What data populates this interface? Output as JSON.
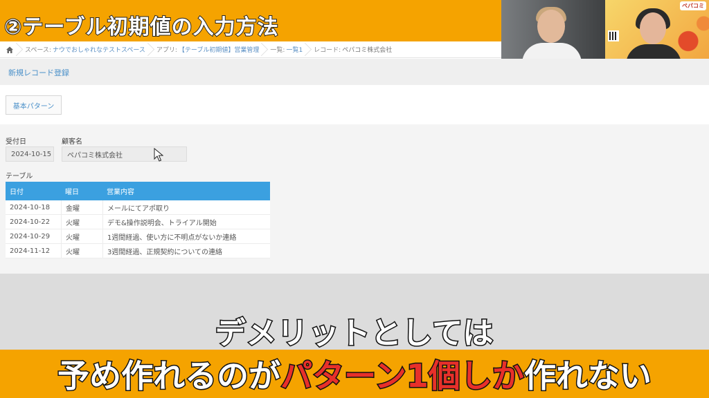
{
  "banner": {
    "title": "②テーブル初期値の入力方法"
  },
  "breadcrumb": [
    {
      "prefix": "スペース:",
      "value": "ナウでおしゃれなテストスペース"
    },
    {
      "prefix": "アプリ:",
      "value": "【テーブル初期値】営業管理"
    },
    {
      "prefix": "一覧:",
      "value": "一覧1"
    },
    {
      "prefix": "レコード:",
      "value": "ペパコミ株式会社"
    }
  ],
  "page": {
    "title": "新規レコード登録",
    "pattern_button": "基本パターン"
  },
  "form": {
    "date_label": "受付日",
    "date_value": "2024-10-15",
    "customer_label": "顧客名",
    "customer_value": "ペパコミ株式会社",
    "table_label": "テーブル"
  },
  "table": {
    "headers": [
      "日付",
      "曜日",
      "営業内容"
    ],
    "rows": [
      [
        "2024-10-18",
        "金曜",
        "メールにてアポ取り"
      ],
      [
        "2024-10-22",
        "火曜",
        "デモ&操作説明会、トライアル開始"
      ],
      [
        "2024-10-29",
        "火曜",
        "1週間経過、使い方に不明点がないか連絡"
      ],
      [
        "2024-11-12",
        "火曜",
        "3週間経過、正規契約についての連絡"
      ]
    ]
  },
  "video": {
    "logo": "ペパコミ"
  },
  "subtitles": {
    "line1": "デメリットとしては",
    "line2_white": "予め作れるのが",
    "line2_red": "パターン1個しか",
    "line2_white_end": "作れない"
  },
  "colors": {
    "banner": "#f5a300",
    "table_header": "#3ba0e0",
    "link": "#4a90c9",
    "subtitle_red": "#e8302a"
  }
}
